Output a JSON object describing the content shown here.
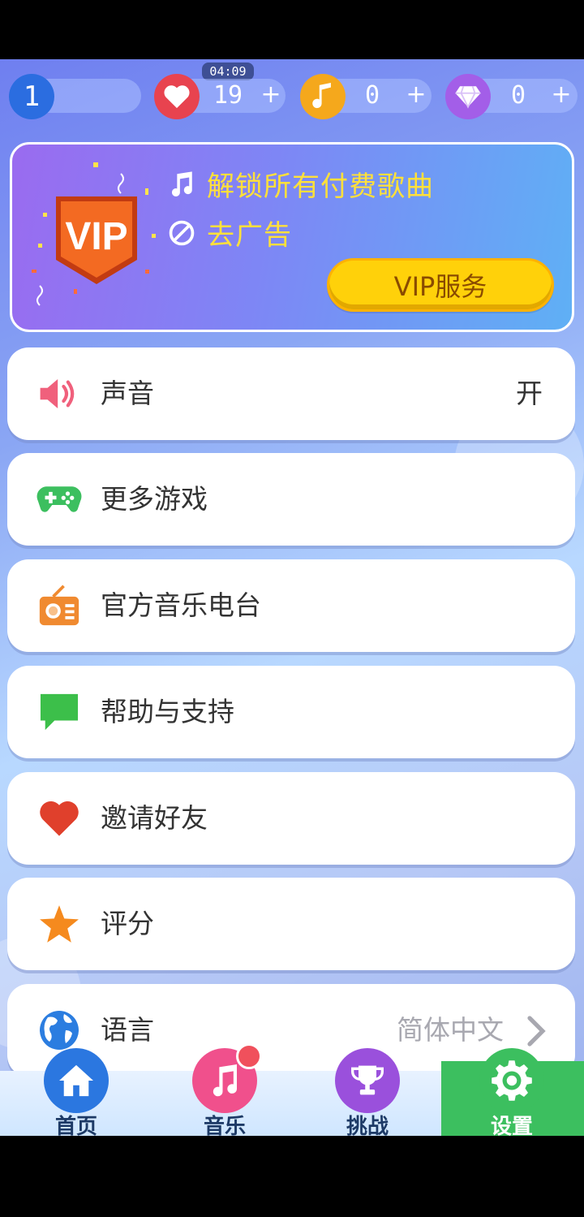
{
  "timer": "04:09",
  "stats": {
    "level": "1",
    "lives": "19",
    "notes": "0",
    "gems": "0",
    "plus": "+"
  },
  "vip": {
    "badge_text": "VIP",
    "feature1": "解锁所有付费歌曲",
    "feature2": "去广告",
    "button": "VIP服务"
  },
  "settings": [
    {
      "label": "声音",
      "value": "开",
      "icon": "speaker-icon"
    },
    {
      "label": "更多游戏",
      "value": "",
      "icon": "gamepad-icon"
    },
    {
      "label": "官方音乐电台",
      "value": "",
      "icon": "radio-icon"
    },
    {
      "label": "帮助与支持",
      "value": "",
      "icon": "chat-bubble-icon"
    },
    {
      "label": "邀请好友",
      "value": "",
      "icon": "heart-icon"
    },
    {
      "label": "评分",
      "value": "",
      "icon": "star-icon"
    },
    {
      "label": "语言",
      "value": "简体中文",
      "icon": "globe-icon"
    }
  ],
  "nav": [
    {
      "label": "首页",
      "icon": "home-icon"
    },
    {
      "label": "音乐",
      "icon": "music-icon"
    },
    {
      "label": "挑战",
      "icon": "trophy-icon"
    },
    {
      "label": "设置",
      "icon": "gear-icon"
    }
  ],
  "colors": {
    "accent_green": "#3cbf5f",
    "vip_yellow": "#ffd10a",
    "heart_red": "#e8434f",
    "note_orange": "#f5a81c",
    "gem_purple": "#a35ee8",
    "level_blue": "#2b6de0"
  }
}
